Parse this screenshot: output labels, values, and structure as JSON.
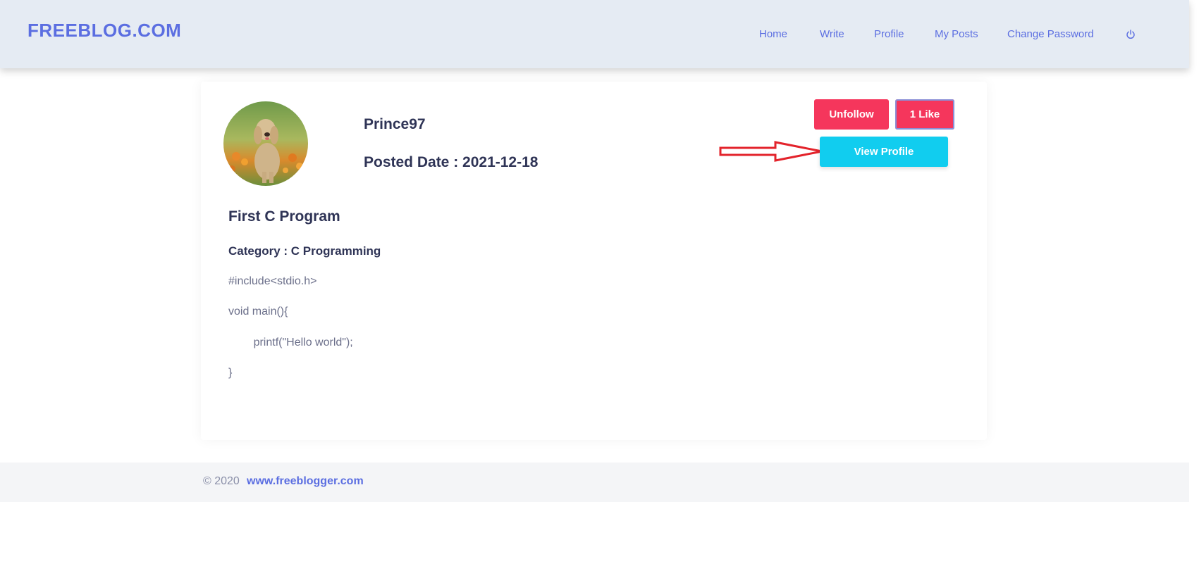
{
  "header": {
    "brand": "FREEBLOG.COM",
    "nav": [
      "Home",
      "Write",
      "Profile",
      "My Posts",
      "Change Password"
    ],
    "power_icon": "power-icon"
  },
  "post": {
    "username": "Prince97",
    "posted_date": "Posted Date : 2021-12-18",
    "buttons": {
      "unfollow": "Unfollow",
      "like": "1 Like",
      "view_profile": "View Profile"
    },
    "title": "First C Program",
    "category": "Category : C Programming",
    "code": [
      "#include<stdio.h>",
      "void main(){",
      "        printf(\"Hello world\");",
      "}"
    ]
  },
  "footer": {
    "copyright": "© 2020",
    "link": "www.freeblogger.com"
  },
  "colors": {
    "brand": "#5b6ee1",
    "danger": "#f5365c",
    "info": "#11cdef",
    "annotation_arrow": "#e3232b"
  }
}
